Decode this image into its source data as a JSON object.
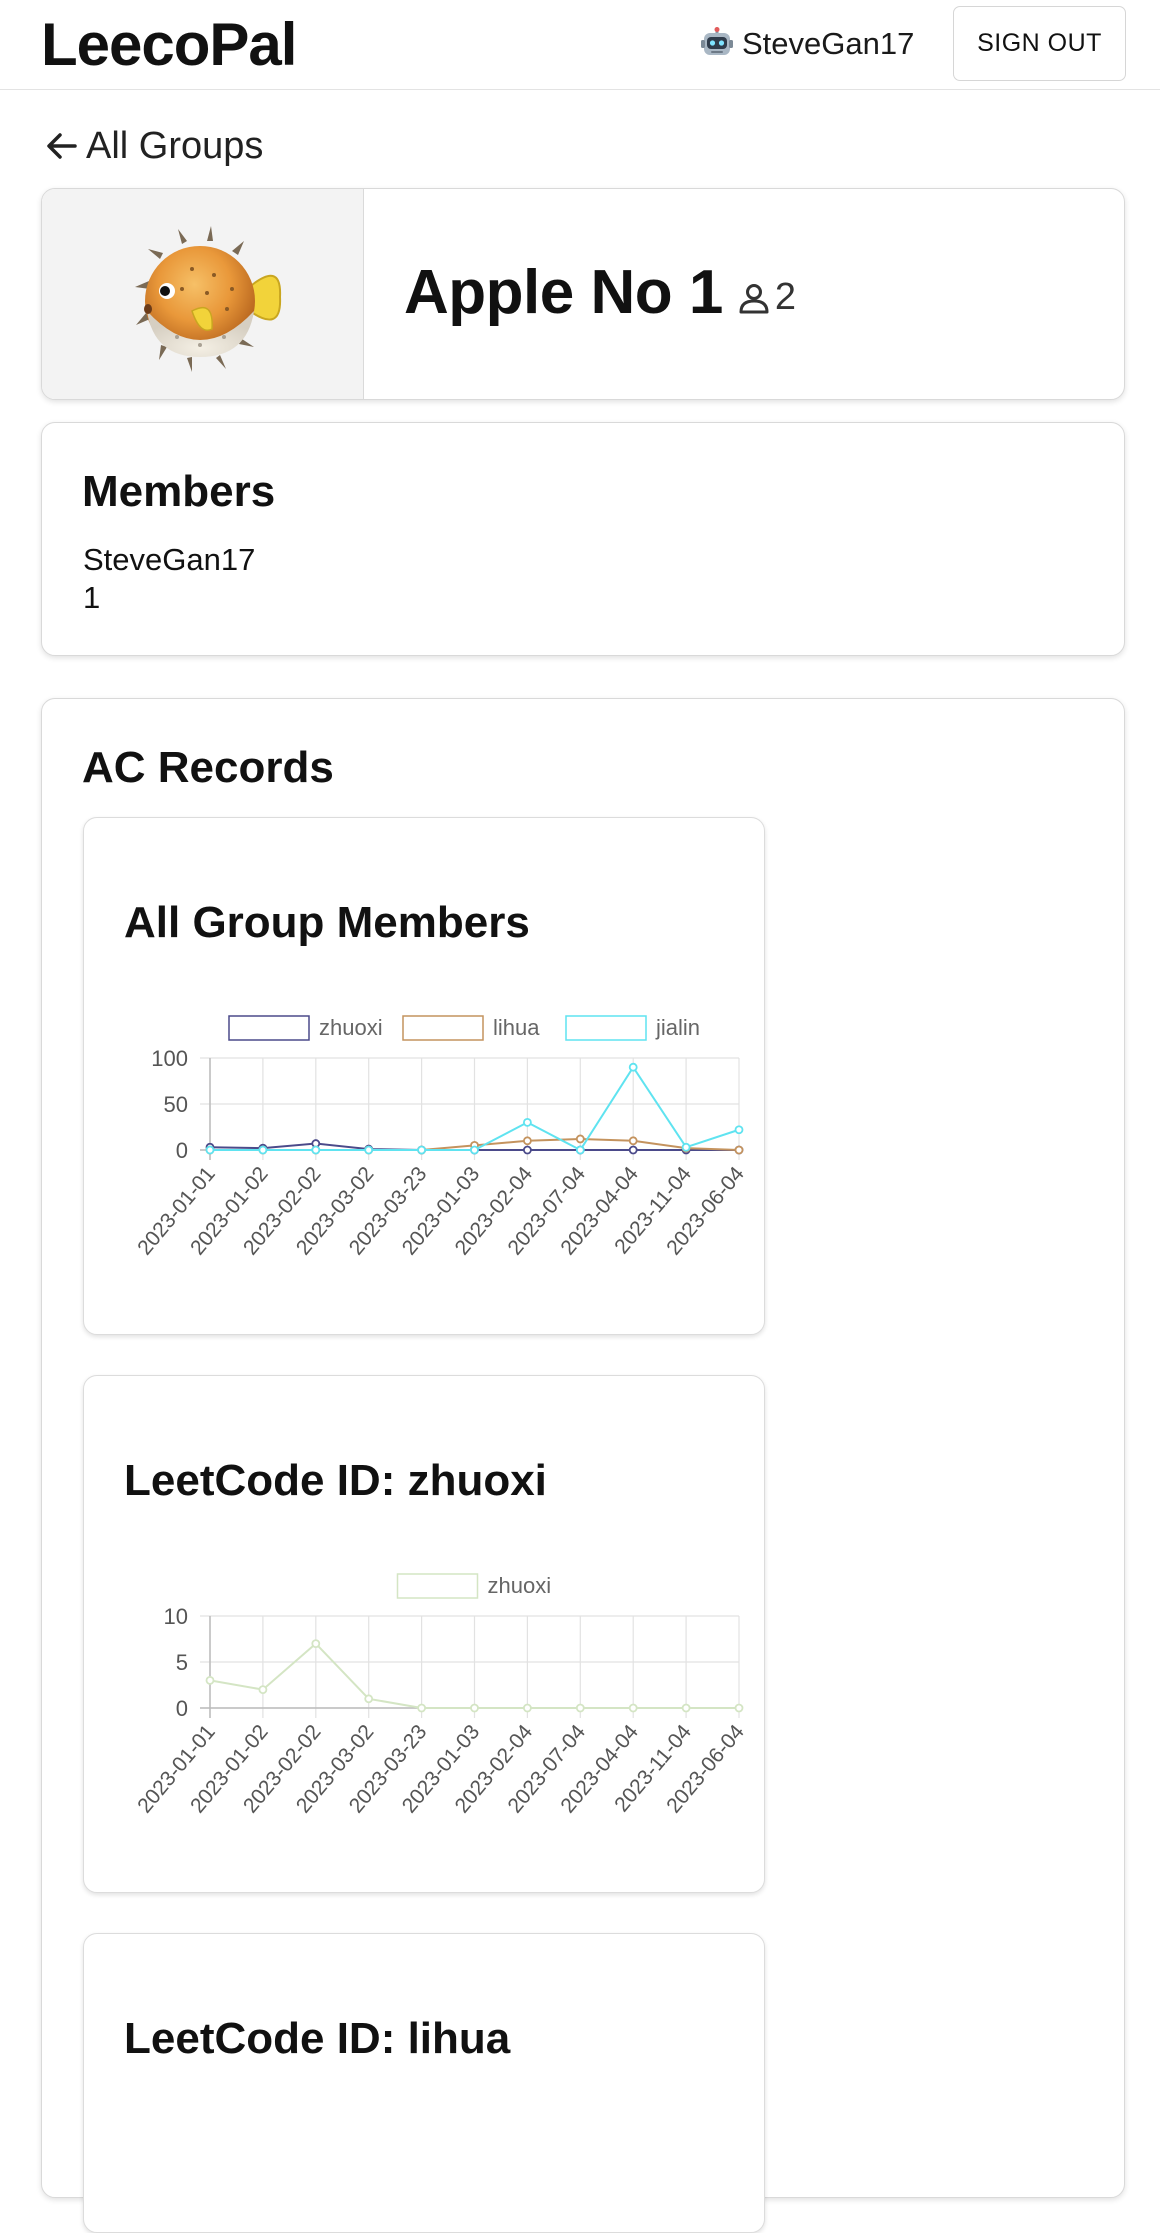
{
  "header": {
    "brand": "LeecoPal",
    "username": "SteveGan17",
    "sign_out_label": "SIGN OUT"
  },
  "back_link": {
    "label": "All Groups"
  },
  "group": {
    "name": "Apple No 1",
    "member_count": "2"
  },
  "members": {
    "title": "Members",
    "items": [
      "SteveGan17",
      "1"
    ]
  },
  "ac_records": {
    "title": "AC Records",
    "charts": [
      {
        "title": "All Group Members"
      },
      {
        "title": "LeetCode ID: zhuoxi"
      },
      {
        "title": "LeetCode ID: lihua"
      }
    ]
  },
  "chart_data": [
    {
      "type": "line",
      "x": [
        "2023-01-01",
        "2023-01-02",
        "2023-02-02",
        "2023-03-02",
        "2023-03-23",
        "2023-01-03",
        "2023-02-04",
        "2023-07-04",
        "2023-04-04",
        "2023-11-04",
        "2023-06-04"
      ],
      "ylim": [
        0,
        100
      ],
      "yticks": [
        0,
        50,
        100
      ],
      "grid": true,
      "legend_position": "top",
      "series": [
        {
          "name": "zhuoxi",
          "color": "#4b4a8a",
          "values": [
            3,
            2,
            7,
            1,
            0,
            0,
            0,
            0,
            0,
            0,
            0
          ]
        },
        {
          "name": "lihua",
          "color": "#c4935e",
          "values": [
            0,
            0,
            0,
            0,
            0,
            5,
            10,
            12,
            10,
            2,
            0
          ]
        },
        {
          "name": "jialin",
          "color": "#5fe3f0",
          "values": [
            0,
            0,
            0,
            0,
            0,
            0,
            30,
            0,
            90,
            3,
            22
          ]
        }
      ]
    },
    {
      "type": "line",
      "x": [
        "2023-01-01",
        "2023-01-02",
        "2023-02-02",
        "2023-03-02",
        "2023-03-23",
        "2023-01-03",
        "2023-02-04",
        "2023-07-04",
        "2023-04-04",
        "2023-11-04",
        "2023-06-04"
      ],
      "ylim": [
        0,
        10
      ],
      "yticks": [
        0,
        5,
        10
      ],
      "grid": true,
      "legend_position": "top",
      "series": [
        {
          "name": "zhuoxi",
          "color": "#d4e5c4",
          "values": [
            3,
            2,
            7,
            1,
            0,
            0,
            0,
            0,
            0,
            0,
            0
          ]
        }
      ]
    }
  ]
}
